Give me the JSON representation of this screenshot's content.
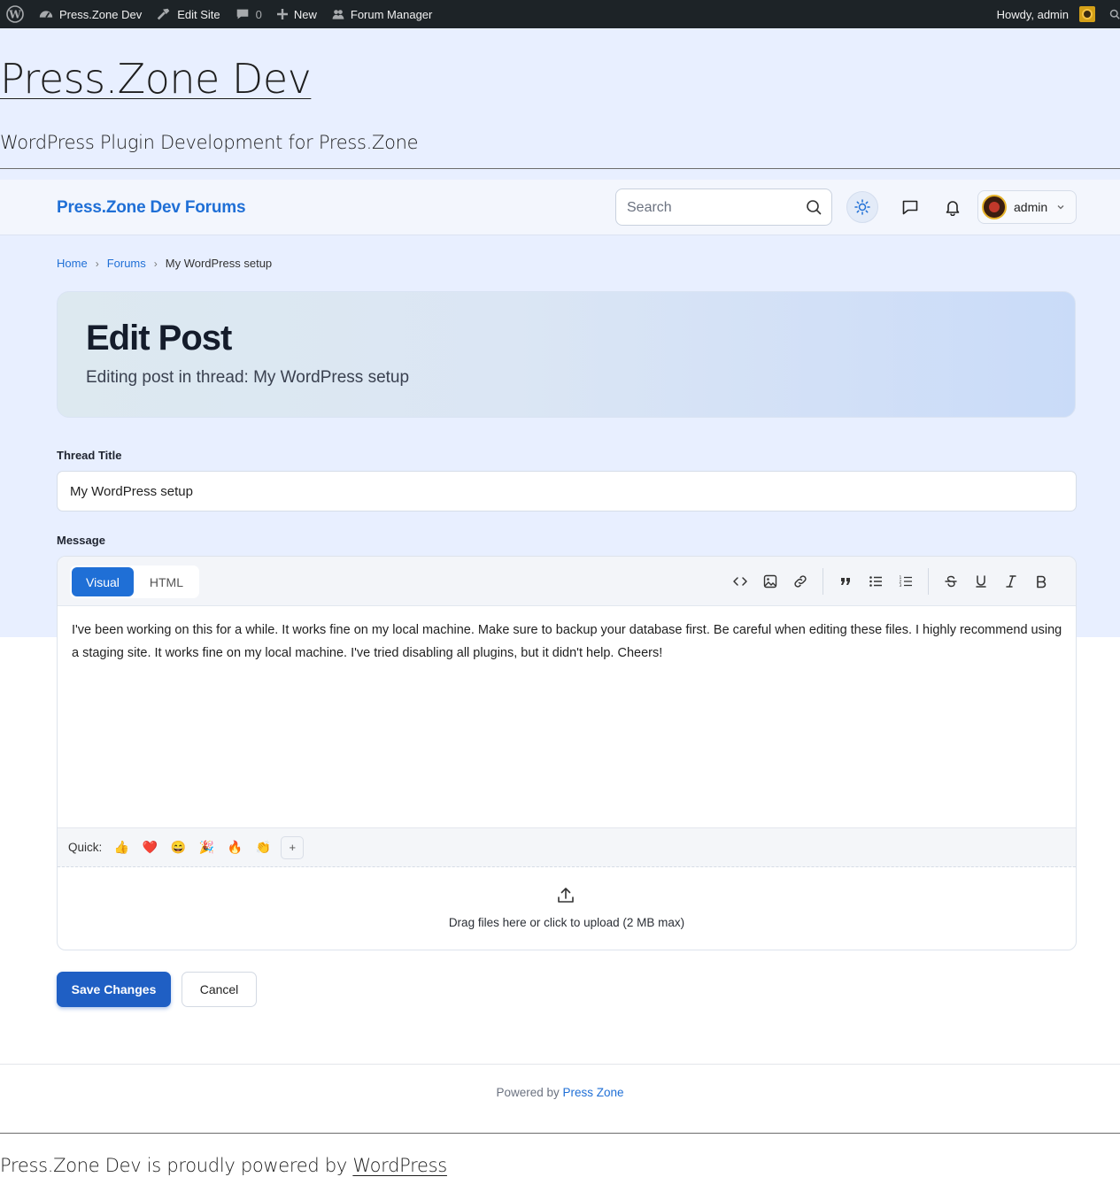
{
  "admin_bar": {
    "site_name": "Press.Zone Dev",
    "edit_site": "Edit Site",
    "comments_count": "0",
    "new_label": "New",
    "forum_manager": "Forum Manager",
    "greeting": "Howdy, admin"
  },
  "site": {
    "title": "Press.Zone Dev",
    "tagline": "WordPress Plugin Development for Press.Zone"
  },
  "forum_header": {
    "brand": "Press.Zone Dev Forums",
    "search_placeholder": "Search",
    "username": "admin"
  },
  "breadcrumb": {
    "home": "Home",
    "forums": "Forums",
    "current": "My WordPress setup"
  },
  "hero": {
    "title": "Edit Post",
    "subtitle": "Editing post in thread: My WordPress setup"
  },
  "form": {
    "thread_title_label": "Thread Title",
    "thread_title_value": "My WordPress setup",
    "message_label": "Message"
  },
  "editor": {
    "tabs": {
      "visual": "Visual",
      "html": "HTML",
      "active": "Visual"
    },
    "content": "I've been working on this for a while. It works fine on my local machine. Make sure to backup your database first. Be careful when editing these files. I highly recommend using a staging site. It works fine on my local machine. I've tried disabling all plugins, but it didn't help. Cheers!",
    "quick_label": "Quick:",
    "quick_emojis": [
      "👍",
      "❤️",
      "😄",
      "🎉",
      "🔥",
      "👏"
    ],
    "quick_more": "+",
    "upload_text": "Drag files here or click to upload (2 MB max)"
  },
  "actions": {
    "save": "Save Changes",
    "cancel": "Cancel"
  },
  "forum_footer": {
    "powered_prefix": "Powered by",
    "powered_link": "Press Zone"
  },
  "site_footer": {
    "prefix": "Press.Zone Dev is proudly powered by",
    "link": "WordPress"
  },
  "colors": {
    "accent": "#1f6fd6",
    "admin_bar": "#1d2327",
    "page_background": "#e8efff"
  }
}
